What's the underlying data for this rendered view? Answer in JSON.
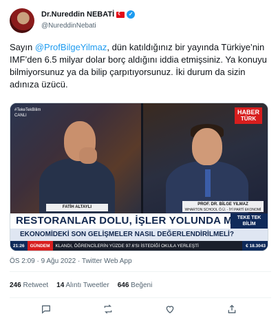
{
  "author": {
    "display_name": "Dr.Nureddin NEBATİ",
    "handle": "@NureddinNebati",
    "verified_icon": "verified-badge-icon",
    "flag_icon": "turkey-flag-icon"
  },
  "tweet": {
    "text_prefix": "Sayın ",
    "mention": "@ProfBilgeYilmaz",
    "text_suffix": ", dün katıldığınız bir yayında Türkiye’nin IMF’den 6.5 milyar dolar borç aldığını iddia etmişsiniz. Ya konuyu bilmiyorsunuz ya da bilip çarpıtıyorsunuz. İki durum da sizin adınıza üzücü."
  },
  "media": {
    "live_tag": "#TekeTekBilim",
    "live_label": "CANLI",
    "channel_logo_top": "HABER",
    "channel_logo_bottom": "TÜRK",
    "guest_left": "FATİH ALTAYLI",
    "guest_right": "PROF. DR. BİLGE YILMAZ",
    "guest_right_role": "WHARTON SCHOOL Ö.Ü. - İYİ PARTİ EKONOMİ POL. BŞK.",
    "headline": "RESTORANLAR DOLU, İŞLER YOLUNDA MI?",
    "show_badge_top": "TEKE TEK",
    "show_badge_bottom": "BİLİM",
    "subline": "EKONOMİDEKİ SON GELİŞMELER NASIL DEĞERLENDİRİLMELİ?",
    "ticker_time": "21:26",
    "ticker_section": "GÜNDEM",
    "ticker_news": "KLANDI, ÖĞRENCİLERİN YÜZDE 97.6'SI İSTEDİĞİ OKULA YERLEŞTİ",
    "ticker_rate": "€ 18.3043"
  },
  "meta": {
    "timestamp": "ÖS 2:09 · 9 Ağu 2022 · Twitter Web App"
  },
  "stats": {
    "retweets_count": "246",
    "retweets_label": "Retweet",
    "quotes_count": "14",
    "quotes_label": "Alıntı Tweetler",
    "likes_count": "646",
    "likes_label": "Beğeni"
  },
  "actions": {
    "reply_icon": "reply-icon",
    "retweet_icon": "retweet-icon",
    "like_icon": "like-icon",
    "share_icon": "share-icon"
  },
  "colors": {
    "link": "#1d9bf0",
    "secondary_text": "#536471",
    "channel_red": "#d81e1e",
    "navy": "#10264d"
  }
}
